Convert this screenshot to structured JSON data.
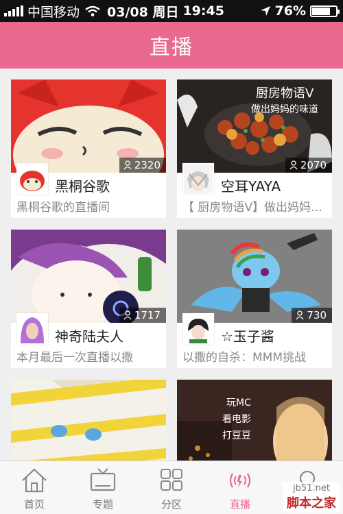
{
  "status_bar": {
    "carrier": "中国移动",
    "date": "03/08 周日",
    "time": "19:45",
    "battery": "76%",
    "battery_level": 0.76
  },
  "nav": {
    "title": "直播"
  },
  "cards": [
    {
      "name": "黑桐谷歌",
      "desc": "黑桐谷歌的直播间",
      "viewers": "2320"
    },
    {
      "name": "空耳YAYA",
      "desc": "【 厨房物语V】做出妈妈的味道",
      "viewers": "2070"
    },
    {
      "name": "神奇陆夫人",
      "desc": "本月最后一次直播以撒",
      "viewers": "1717"
    },
    {
      "name": "☆玉子酱",
      "desc": "以撒的自杀：MMM挑战",
      "viewers": "730"
    },
    {
      "name": "",
      "desc": "",
      "viewers": ""
    },
    {
      "name": "",
      "desc": "",
      "viewers": ""
    }
  ],
  "thumb_text": {
    "kitchen_title": "厨房物语V",
    "kitchen_sub": "做出妈妈的味道",
    "mc_line1": "玩MC",
    "mc_line2": "看电影",
    "mc_line3": "打豆豆"
  },
  "tabs": [
    {
      "label": "首页",
      "icon": "home-icon",
      "active": false
    },
    {
      "label": "专题",
      "icon": "tv-icon",
      "active": false
    },
    {
      "label": "分区",
      "icon": "grid-icon",
      "active": false
    },
    {
      "label": "直播",
      "icon": "broadcast-icon",
      "active": true
    },
    {
      "label": "",
      "icon": "search-icon",
      "active": false
    }
  ],
  "watermark": {
    "top": "jb51.net",
    "bottom": "脚本之家"
  },
  "colors": {
    "accent": "#e9698f",
    "status_bar": "#111111"
  }
}
